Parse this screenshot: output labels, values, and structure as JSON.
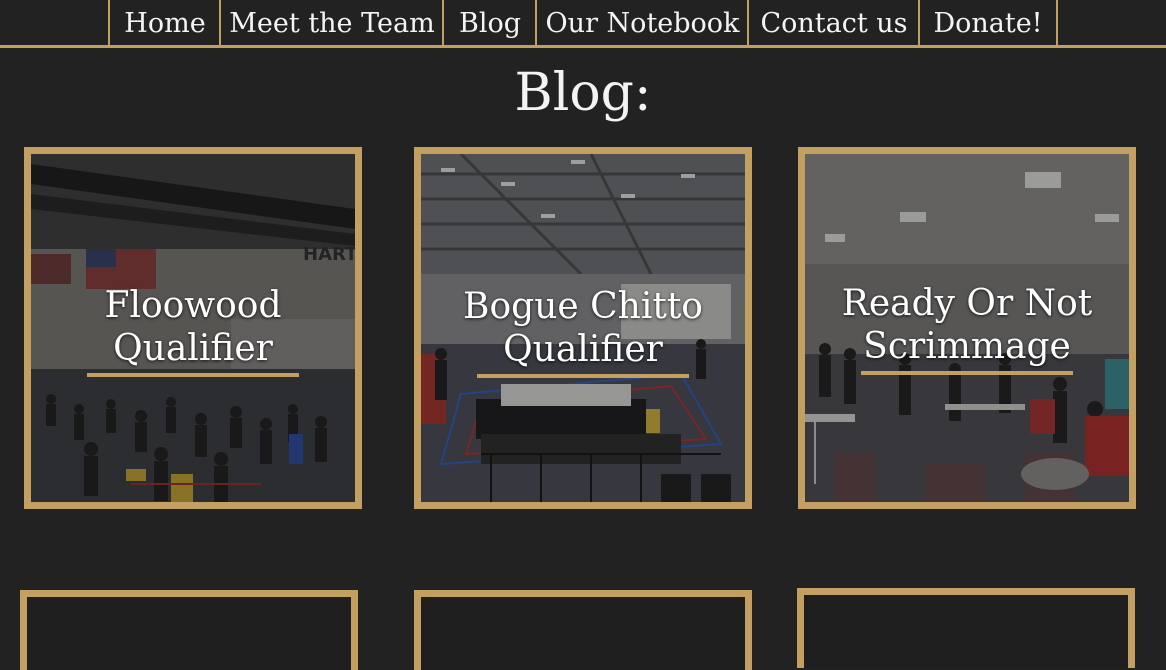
{
  "nav": {
    "items": [
      {
        "label": "Home"
      },
      {
        "label": "Meet the Team"
      },
      {
        "label": "Blog"
      },
      {
        "label": "Our Notebook"
      },
      {
        "label": "Contact us"
      },
      {
        "label": "Donate!"
      }
    ]
  },
  "page": {
    "title": "Blog:"
  },
  "posts": [
    {
      "title_line1": "Floowood",
      "title_line2": "Qualifier",
      "photo_sign": "HART"
    },
    {
      "title_line1": "Bogue Chitto",
      "title_line2": "Qualifier"
    },
    {
      "title_line1": "Ready Or Not",
      "title_line2": "Scrimmage"
    }
  ],
  "colors": {
    "background": "#222222",
    "accent_gold": "#c3a062",
    "text": "#f4f4f4"
  }
}
